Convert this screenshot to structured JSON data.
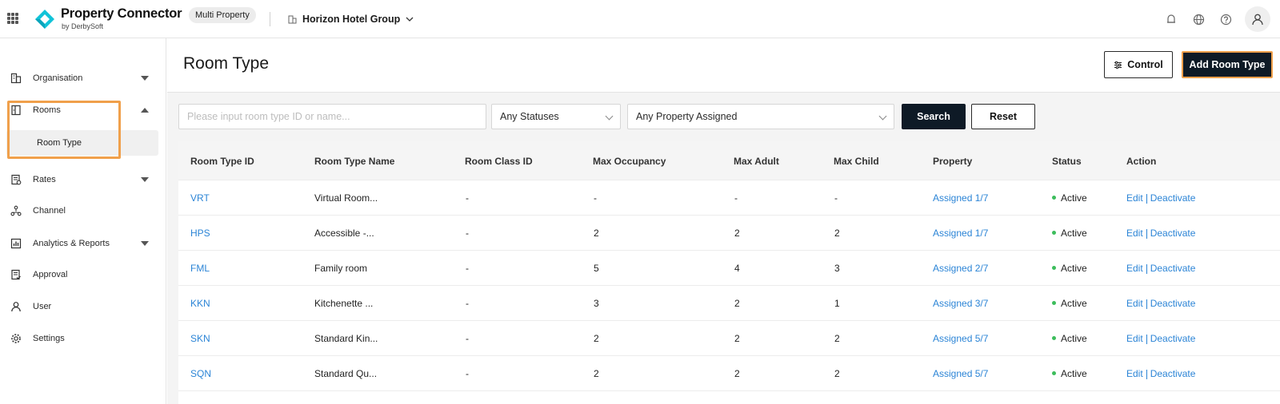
{
  "app": {
    "name": "Property Connector",
    "sub": "by DerbySoft",
    "badge": "Multi Property",
    "group": "Horizon Hotel Group"
  },
  "header_icons": [
    "notification-icon",
    "globe-icon",
    "help-icon",
    "user-avatar-icon"
  ],
  "sidebar": {
    "items": [
      {
        "label": "Organisation",
        "icon": "building-icon"
      },
      {
        "label": "Rooms",
        "icon": "door-icon"
      },
      {
        "label": "Rates",
        "icon": "rates-icon"
      },
      {
        "label": "Channel",
        "icon": "channel-icon"
      },
      {
        "label": "Analytics & Reports",
        "icon": "chart-icon"
      },
      {
        "label": "Approval",
        "icon": "approval-icon"
      },
      {
        "label": "User",
        "icon": "user-icon"
      },
      {
        "label": "Settings",
        "icon": "gear-icon"
      }
    ],
    "sub_item": "Room Type"
  },
  "page": {
    "title": "Room Type",
    "control_label": "Control",
    "add_label": "Add Room Type"
  },
  "filters": {
    "search_placeholder": "Please input room type ID or name...",
    "status_value": "Any Statuses",
    "property_value": "Any Property Assigned",
    "search_label": "Search",
    "reset_label": "Reset"
  },
  "table": {
    "headers": [
      "Room Type ID",
      "Room Type Name",
      "Room Class ID",
      "Max Occupancy",
      "Max Adult",
      "Max Child",
      "Property",
      "Status",
      "Action"
    ],
    "edit_label": "Edit",
    "deactivate_label": "Deactivate",
    "rows": [
      {
        "id": "VRT",
        "name": "Virtual Room...",
        "class_id": "-",
        "max_occ": "-",
        "max_adult": "-",
        "max_child": "-",
        "property": "Assigned 1/7",
        "status": "Active"
      },
      {
        "id": "HPS",
        "name": "Accessible -...",
        "class_id": "-",
        "max_occ": "2",
        "max_adult": "2",
        "max_child": "2",
        "property": "Assigned 1/7",
        "status": "Active"
      },
      {
        "id": "FML",
        "name": "Family room",
        "class_id": "-",
        "max_occ": "5",
        "max_adult": "4",
        "max_child": "3",
        "property": "Assigned 2/7",
        "status": "Active"
      },
      {
        "id": "KKN",
        "name": "Kitchenette ...",
        "class_id": "-",
        "max_occ": "3",
        "max_adult": "2",
        "max_child": "1",
        "property": "Assigned 3/7",
        "status": "Active"
      },
      {
        "id": "SKN",
        "name": "Standard Kin...",
        "class_id": "-",
        "max_occ": "2",
        "max_adult": "2",
        "max_child": "2",
        "property": "Assigned 5/7",
        "status": "Active"
      },
      {
        "id": "SQN",
        "name": "Standard Qu...",
        "class_id": "-",
        "max_occ": "2",
        "max_adult": "2",
        "max_child": "2",
        "property": "Assigned 5/7",
        "status": "Active"
      }
    ]
  },
  "colors": {
    "accent": "#0e1a26",
    "link": "#2b84d6",
    "highlight": "#f0a04b",
    "active_dot": "#3dbd5c",
    "logo": "#11c3d8"
  }
}
